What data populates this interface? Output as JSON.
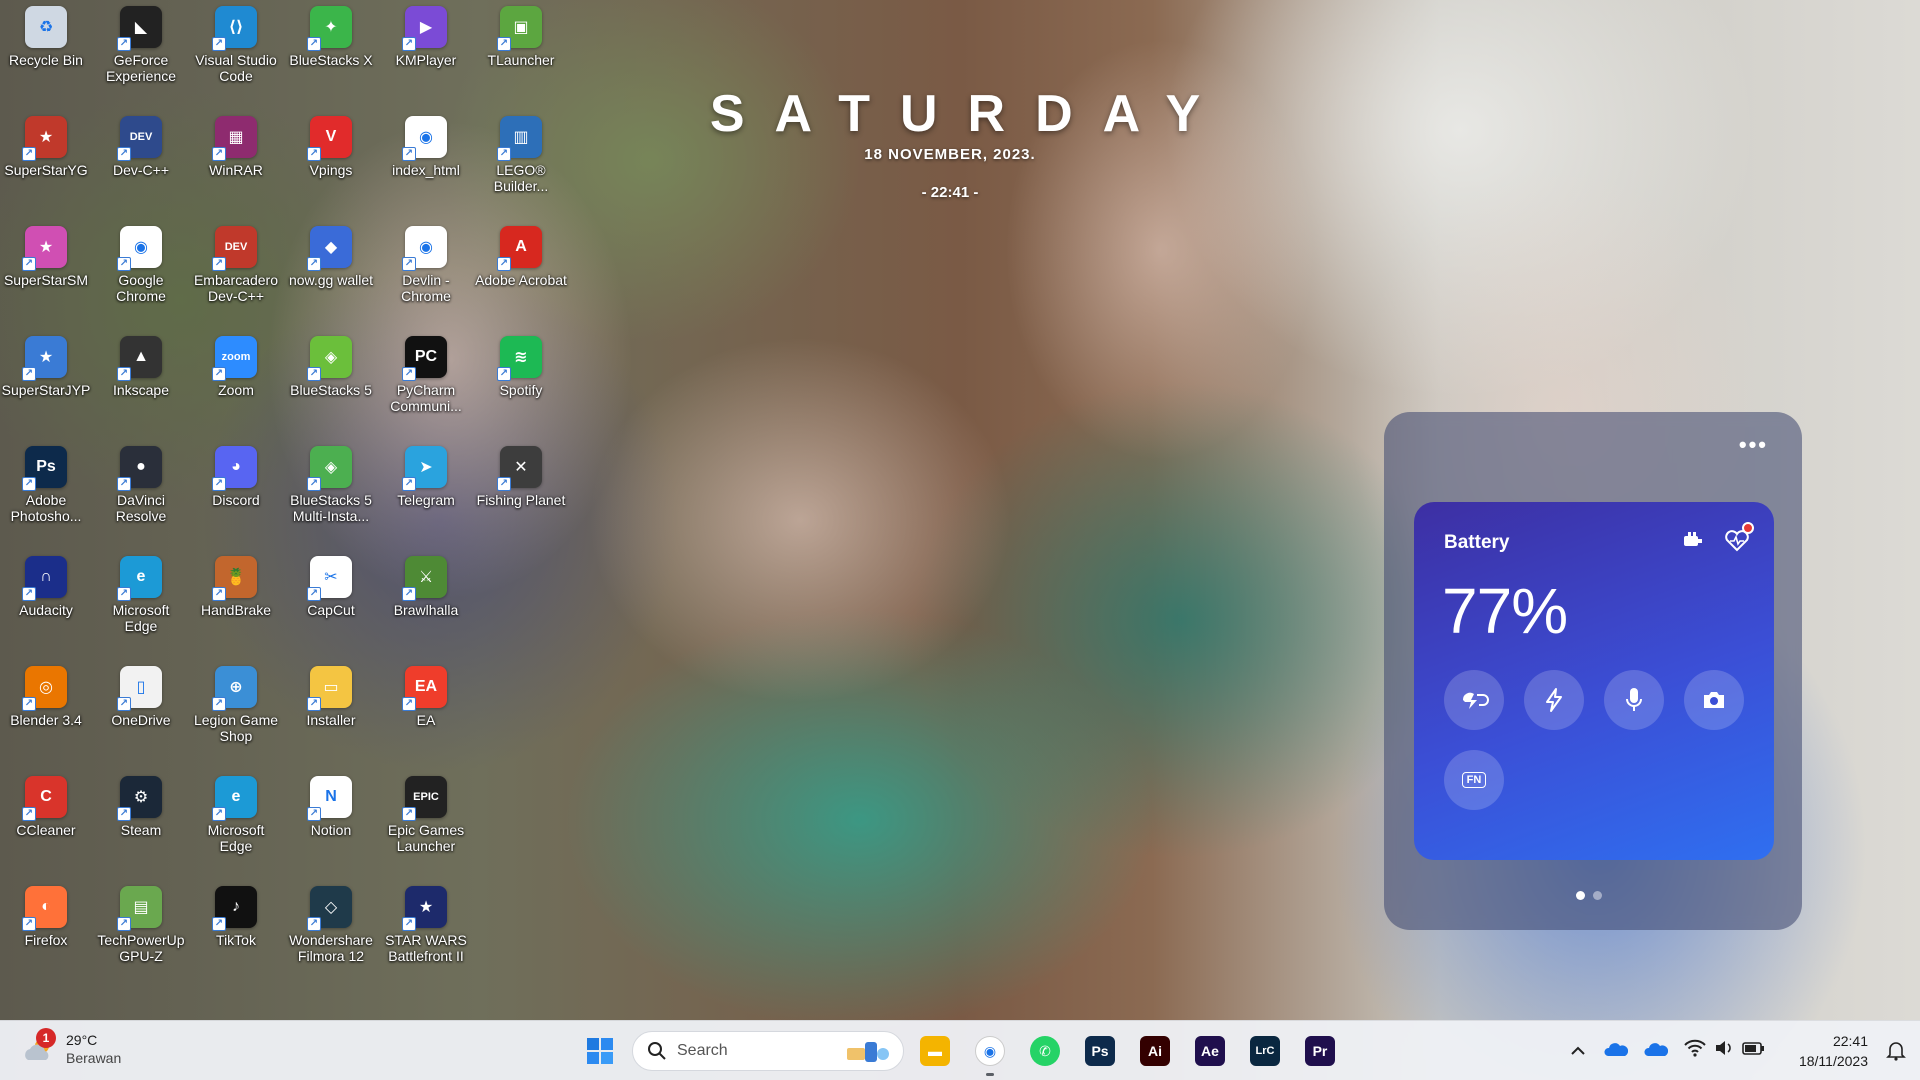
{
  "desktop": {
    "icons": [
      {
        "label": "Recycle Bin",
        "icon": "recycle-bin-icon",
        "color": "#cfd8e3",
        "txt": "♻"
      },
      {
        "label": "GeForce Experience",
        "icon": "geforce-icon",
        "color": "#222222",
        "txt": "◣"
      },
      {
        "label": "Visual Studio Code",
        "icon": "vscode-icon",
        "color": "#1f8ad2",
        "txt": "⟨⟩"
      },
      {
        "label": "BlueStacks X",
        "icon": "bluestacks-x-icon",
        "color": "#3bb54a",
        "txt": "✦"
      },
      {
        "label": "KMPlayer",
        "icon": "kmplayer-icon",
        "color": "#7b4bd6",
        "txt": "▶"
      },
      {
        "label": "TLauncher",
        "icon": "tlauncher-icon",
        "color": "#5ca640",
        "txt": "▣"
      },
      {
        "label": "SuperStarYG",
        "icon": "superstar-yg-icon",
        "color": "#c0392b",
        "txt": "★"
      },
      {
        "label": "Dev-C++",
        "icon": "devcpp-icon",
        "color": "#2e4a8c",
        "txt": "DEV"
      },
      {
        "label": "WinRAR",
        "icon": "winrar-icon",
        "color": "#8e2b6f",
        "txt": "▦"
      },
      {
        "label": "Vpings",
        "icon": "vpings-icon",
        "color": "#e12b2b",
        "txt": "V"
      },
      {
        "label": "index_html",
        "icon": "chrome-icon",
        "color": "#ffffff",
        "txt": "◉"
      },
      {
        "label": "LEGO® Builder...",
        "icon": "lego-icon",
        "color": "#2d6fb8",
        "txt": "▥"
      },
      {
        "label": "SuperStarSM",
        "icon": "superstar-sm-icon",
        "color": "#d04fb3",
        "txt": "★"
      },
      {
        "label": "Google Chrome",
        "icon": "chrome-icon",
        "color": "#ffffff",
        "txt": "◉"
      },
      {
        "label": "Embarcadero Dev-C++",
        "icon": "embarcadero-icon",
        "color": "#c0392b",
        "txt": "DEV"
      },
      {
        "label": "now.gg wallet",
        "icon": "nowgg-icon",
        "color": "#3a6bd8",
        "txt": "◆"
      },
      {
        "label": "Devlin - Chrome",
        "icon": "chrome-profile-icon",
        "color": "#ffffff",
        "txt": "◉"
      },
      {
        "label": "Adobe Acrobat",
        "icon": "acrobat-icon",
        "color": "#d7281f",
        "txt": "A"
      },
      {
        "label": "SuperStarJYP",
        "icon": "superstar-jyp-icon",
        "color": "#3a7bd5",
        "txt": "★"
      },
      {
        "label": "Inkscape",
        "icon": "inkscape-icon",
        "color": "#333333",
        "txt": "▲"
      },
      {
        "label": "Zoom",
        "icon": "zoom-icon",
        "color": "#2d8cff",
        "txt": "zoom"
      },
      {
        "label": "BlueStacks 5",
        "icon": "bluestacks-5-icon",
        "color": "#6bbf3b",
        "txt": "◈"
      },
      {
        "label": "PyCharm Communi...",
        "icon": "pycharm-icon",
        "color": "#111111",
        "txt": "PC"
      },
      {
        "label": "Spotify",
        "icon": "spotify-icon",
        "color": "#1db954",
        "txt": "≋"
      },
      {
        "label": "Adobe Photosho...",
        "icon": "photoshop-icon",
        "color": "#0d2a4b",
        "txt": "Ps"
      },
      {
        "label": "DaVinci Resolve",
        "icon": "davinci-icon",
        "color": "#2a2f3a",
        "txt": "●"
      },
      {
        "label": "Discord",
        "icon": "discord-icon",
        "color": "#5865f2",
        "txt": "◕"
      },
      {
        "label": "BlueStacks 5 Multi-Insta...",
        "icon": "bluestacks-multi-icon",
        "color": "#4caf50",
        "txt": "◈"
      },
      {
        "label": "Telegram",
        "icon": "telegram-icon",
        "color": "#2aa3de",
        "txt": "➤"
      },
      {
        "label": "Fishing Planet",
        "icon": "fishing-planet-icon",
        "color": "#3d3d3d",
        "txt": "✕"
      },
      {
        "label": "Audacity",
        "icon": "audacity-icon",
        "color": "#1b2e8a",
        "txt": "∩"
      },
      {
        "label": "Microsoft Edge",
        "icon": "edge-icon",
        "color": "#1c9ad6",
        "txt": "e"
      },
      {
        "label": "HandBrake",
        "icon": "handbrake-icon",
        "color": "#c2662d",
        "txt": "🍍"
      },
      {
        "label": "CapCut",
        "icon": "capcut-icon",
        "color": "#ffffff",
        "txt": "✂"
      },
      {
        "label": "Brawlhalla",
        "icon": "brawlhalla-icon",
        "color": "#4e8a35",
        "txt": "⚔"
      },
      {
        "label": "Blender 3.4",
        "icon": "blender-icon",
        "color": "#ea7600",
        "txt": "◎"
      },
      {
        "label": "OneDrive",
        "icon": "onedrive-file-icon",
        "color": "#f2f2f2",
        "txt": "▯"
      },
      {
        "label": "Legion Game Shop",
        "icon": "legion-icon",
        "color": "#3b8fd6",
        "txt": "⊕"
      },
      {
        "label": "Installer",
        "icon": "folder-icon",
        "color": "#f4c542",
        "txt": "▭"
      },
      {
        "label": "EA",
        "icon": "ea-icon",
        "color": "#ef3d2b",
        "txt": "EA"
      },
      {
        "label": "CCleaner",
        "icon": "ccleaner-icon",
        "color": "#d9342b",
        "txt": "C"
      },
      {
        "label": "Steam",
        "icon": "steam-icon",
        "color": "#1b2838",
        "txt": "⚙"
      },
      {
        "label": "Microsoft Edge",
        "icon": "edge-icon",
        "color": "#1c9ad6",
        "txt": "e"
      },
      {
        "label": "Notion",
        "icon": "notion-icon",
        "color": "#ffffff",
        "txt": "N"
      },
      {
        "label": "Epic Games Launcher",
        "icon": "epic-games-icon",
        "color": "#222222",
        "txt": "EPIC"
      },
      {
        "label": "Firefox",
        "icon": "firefox-icon",
        "color": "#ff7139",
        "txt": "◐"
      },
      {
        "label": "TechPowerUp GPU-Z",
        "icon": "gpuz-icon",
        "color": "#6aa84f",
        "txt": "▤"
      },
      {
        "label": "TikTok",
        "icon": "tiktok-icon",
        "color": "#111111",
        "txt": "♪"
      },
      {
        "label": "Wondershare Filmora 12",
        "icon": "filmora-icon",
        "color": "#1f3a4a",
        "txt": "◇"
      },
      {
        "label": "STAR WARS Battlefront II",
        "icon": "battlefront-icon",
        "color": "#1d2a6b",
        "txt": "★"
      }
    ]
  },
  "clock_widget": {
    "day": "SATURDAY",
    "date": "18  NOVEMBER, 2023.",
    "time": "- 22:41 -"
  },
  "battery_widget": {
    "more": "•••",
    "title": "Battery",
    "percent": "77%",
    "toggles": [
      "power-mode-icon",
      "lightning-icon",
      "microphone-icon",
      "camera-icon",
      "fn-key-icon"
    ],
    "fn_label": "FN",
    "page": 1,
    "page_count": 2
  },
  "taskbar": {
    "weather": {
      "badge": "1",
      "temperature": "29°C",
      "condition": "Berawan"
    },
    "search": {
      "placeholder": "Search"
    },
    "apps": [
      {
        "name": "file-explorer-icon",
        "txt": "▬",
        "color": "#f4b400"
      },
      {
        "name": "chrome-icon",
        "txt": "◉",
        "color": "#ffffff"
      },
      {
        "name": "whatsapp-icon",
        "txt": "✆",
        "color": "#25d366"
      },
      {
        "name": "photoshop-icon",
        "txt": "Ps",
        "color": "#0d2a4b"
      },
      {
        "name": "illustrator-icon",
        "txt": "Ai",
        "color": "#330000"
      },
      {
        "name": "after-effects-icon",
        "txt": "Ae",
        "color": "#1f0f4d"
      },
      {
        "name": "lightroom-classic-icon",
        "txt": "LrC",
        "color": "#0a2740"
      },
      {
        "name": "premiere-icon",
        "txt": "Pr",
        "color": "#1f0f4d"
      }
    ],
    "clock": {
      "time": "22:41",
      "date": "18/11/2023"
    }
  }
}
